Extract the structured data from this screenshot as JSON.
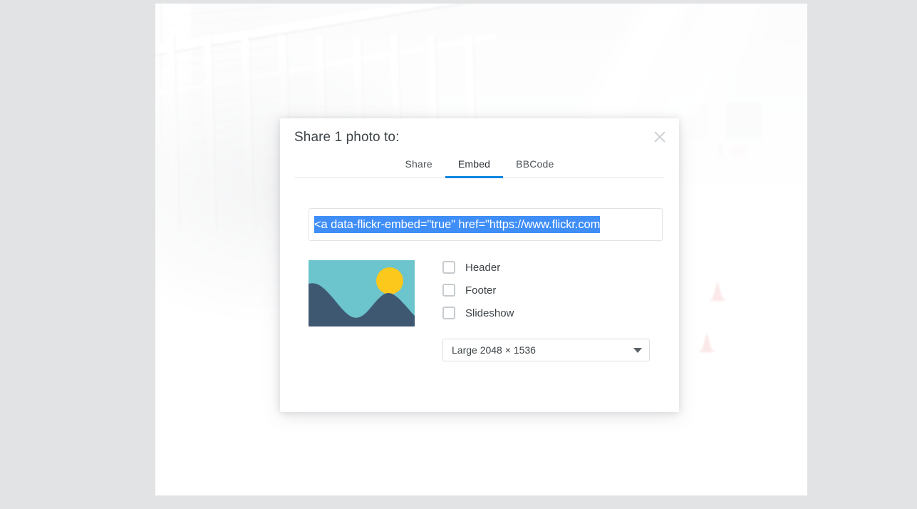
{
  "background": {
    "description": "faded-photo-backdrop",
    "page_bg_color": "#e2e3e5"
  },
  "modal": {
    "title": "Share 1 photo to:",
    "close_icon": "close-icon",
    "tabs": [
      {
        "label": "Share",
        "active": false
      },
      {
        "label": "Embed",
        "active": true
      },
      {
        "label": "BBCode",
        "active": false
      }
    ],
    "active_tab_color": "#0f87e0",
    "embed_input": {
      "value": "<a data-flickr-embed=\"true\"  href=\"https://www.flickr.com",
      "selected": true,
      "selection_color": "#3f8ef7"
    },
    "preview": {
      "icon": "image-placeholder-icon",
      "sky_color": "#6cc4cd",
      "sun_color": "#fcc81c",
      "mountain_color": "#3f5871"
    },
    "options": [
      {
        "label": "Header",
        "checked": false
      },
      {
        "label": "Footer",
        "checked": false
      },
      {
        "label": "Slideshow",
        "checked": false
      }
    ],
    "size_select": {
      "value": "Large 2048 × 1536",
      "caret_icon": "chevron-down-icon"
    }
  }
}
